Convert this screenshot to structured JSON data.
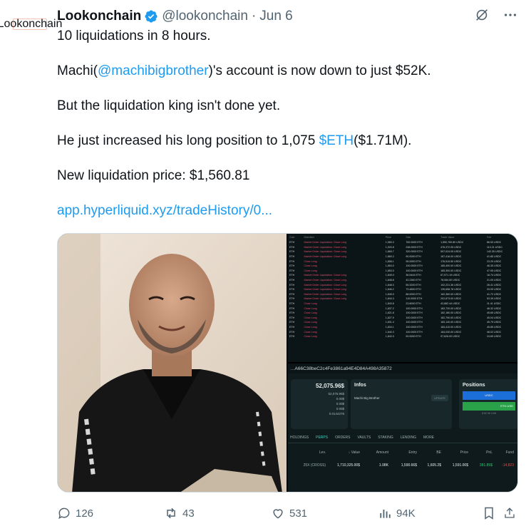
{
  "tweet": {
    "author_name": "Lookonchain",
    "avatar_text": "Lookonchain",
    "handle": "@lookonchain",
    "separator": "·",
    "date": "Jun 6",
    "lines": {
      "l1": "10 liquidations in 8 hours.",
      "l2_pre": "Machi(",
      "l2_mention": "@machibigbrother",
      "l2_post": ")'s account is now down to just $52K.",
      "l3": "But the liquidation king isn't done yet.",
      "l4_pre": "He just increased his long position to 1,075 ",
      "l4_cashtag": "$ETH",
      "l4_post": "($1.71M).",
      "l5": "New liquidation price: $1,560.81",
      "link": "app.hyperliquid.xyz/tradeHistory/0..."
    }
  },
  "media": {
    "table": {
      "headers": [
        "Coin",
        "Direction",
        "Price",
        "Size",
        "Trade Value",
        "Fee"
      ],
      "rows": [
        [
          "ETH",
          "Market Order Liquidation: Close Long",
          "1,983.3",
          "782.0000 ETH",
          "1,550,769.80 USDC",
          "86.53 USDC"
        ],
        [
          "ETH",
          "Market Order Liquidation: Close Long",
          "1,920.8",
          "248.0000 ETH",
          "476,372.05 USDC",
          "113.21 USDC"
        ],
        [
          "ETH",
          "Market Order Liquidation: Close Long",
          "1,865.7",
          "320.0000 ETH",
          "597,024.05 USDC",
          "142.35 USDC"
        ],
        [
          "ETH",
          "Market Order Liquidation: Close Long",
          "1,860.2",
          "90.0000 ETH",
          "167,416.00 USDC",
          "41.85 USDC"
        ],
        [
          "ETH",
          "Close Long",
          "1,858.1",
          "95.0000 ETH",
          "176,519.50 USDC",
          "23.29 USDC"
        ],
        [
          "ETH",
          "Close Long",
          "1,854.0",
          "100.0000 ETH",
          "185,400.00 USDC",
          "46.35 USDC"
        ],
        [
          "ETH",
          "Close Long",
          "1,853.0",
          "100.0000 ETH",
          "185,300.00 USDC",
          "47.95 USDC"
        ],
        [
          "ETH",
          "Market Order Liquidation: Close Long",
          "1,849.0",
          "36.5444 ETH",
          "67,571.19 USDC",
          "16.74 USDC"
        ],
        [
          "ETH",
          "Market Order Liquidation: Close Long",
          "1,848.8",
          "42.2360 ETH",
          "78,084.50 USDC",
          "21.09 USDC"
        ],
        [
          "ETH",
          "Market Order Liquidation: Close Long",
          "1,848.0",
          "55.3200 ETH",
          "102,231.36 USDC",
          "26.41 USDC"
        ],
        [
          "ETH",
          "Market Order Liquidation: Close Long",
          "1,846.2",
          "73.4800 ETH",
          "135,658.78 USDC",
          "33.09 USDC"
        ],
        [
          "ETH",
          "Market Order Liquidation: Close Long",
          "1,845.0",
          "88.0000 ETH",
          "162,360.00 USDC",
          "41.72 USDC"
        ],
        [
          "ETH",
          "Market Order Liquidation: Close Long",
          "1,844.3",
          "110.0000 ETH",
          "202,873.00 USDC",
          "53.39 USDC"
        ],
        [
          "ETH",
          "Close Long",
          "1,843.8",
          "23.8000 ETH",
          "43,882.44 USDC",
          "11.41 USDC"
        ],
        [
          "ETH",
          "Close Long",
          "1,837.2",
          "100.0000 ETH",
          "183,720.00 USDC",
          "46.32 USDC"
        ],
        [
          "ETH",
          "Close Long",
          "1,821.8",
          "100.0000 ETH",
          "182,180.00 USDC",
          "45.65 USDC"
        ],
        [
          "ETH",
          "Close Long",
          "1,827.9",
          "100.0000 ETH",
          "182,790.00 USDC",
          "45.04 USDC"
        ],
        [
          "ETH",
          "Close Long",
          "1,831.4",
          "100.0000 ETH",
          "183,140.00 USDC",
          "45.79 USDC"
        ],
        [
          "ETH",
          "Close Long",
          "1,834.1",
          "100.0000 ETH",
          "183,410.00 USDC",
          "45.85 USDC"
        ],
        [
          "ETH",
          "Close Long",
          "1,840.3",
          "100.0000 ETH",
          "184,030.00 USDC",
          "46.02 USDC"
        ],
        [
          "ETH",
          "Close Long",
          "1,842.0",
          "53.0000 ETH",
          "97,626.00 USDC",
          "24.69 USDC"
        ]
      ]
    },
    "dashboard": {
      "address": "…A66C38beC2c4Fe3861a94E4D84A498A35872",
      "equity": "52,075.96$",
      "equity_rows": [
        "52,075.96$",
        "0.00$",
        "0.00$",
        "0.00$",
        "0.0144278"
      ],
      "infos_title": "Infos",
      "infos_name": "Machi Big Brother",
      "infos_btn": "UPDATE",
      "positions_title": "Positions",
      "positions_rows": [
        "USDC",
        "ETH-USD"
      ],
      "positions_sub": "$ 52.3K 0.65",
      "tabs": [
        "HOLDINGS",
        "PERPS",
        "ORDERS",
        "VAULTS",
        "STAKING",
        "LENDING",
        "MORE"
      ],
      "cols": [
        "Lev.",
        "↓ Value",
        "Amount",
        "Entry",
        "BE",
        "Price",
        "PnL",
        "Fund"
      ],
      "row": [
        "25X (CROSS)",
        "1,710,325.00$",
        "1.08K",
        "1,590.66$",
        "1,605.2$",
        "1,591.00$",
        "381.85$",
        "-14,823"
      ]
    }
  },
  "actions": {
    "replies": "126",
    "reposts": "43",
    "likes": "531",
    "views": "94K"
  },
  "colors": {
    "text": "#0f1419",
    "muted": "#536471",
    "link": "#1d9bf0",
    "verified": "#1d9bf0",
    "brand_avatar": "#e0552e"
  }
}
